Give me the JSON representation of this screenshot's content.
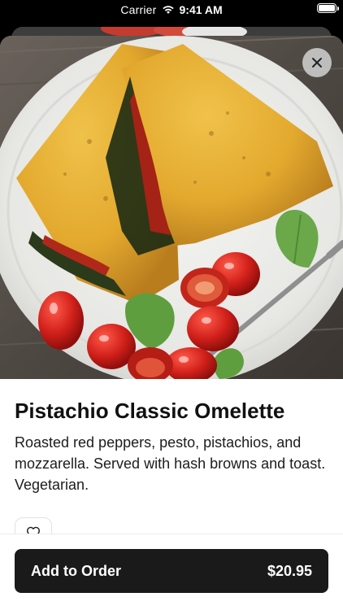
{
  "status_bar": {
    "carrier": "Carrier",
    "time": "9:41 AM",
    "icons": [
      "wifi-icon",
      "battery-icon"
    ]
  },
  "item": {
    "title": "Pistachio Classic Omelette",
    "description": "Roasted red peppers, pesto, pistachios, and mozzarella. Served with hash browns and toast. Vegetarian.",
    "image_alt": "Omelette with tomatoes and basil"
  },
  "actions": {
    "close_icon": "close-icon",
    "favorite_icon": "heart-icon",
    "add_to_order_label": "Add to Order",
    "price": "$20.95"
  },
  "colors": {
    "button_bg": "#1a1a1a",
    "sheet_bg": "#ffffff",
    "text_primary": "#111111"
  }
}
